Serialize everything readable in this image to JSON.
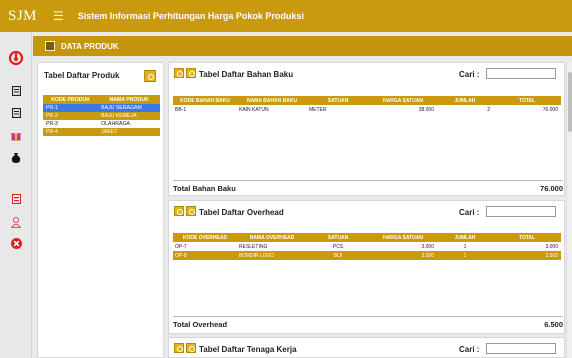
{
  "app": {
    "logo": "SJM",
    "title": "Sistem Informasi Perhitungan Harga Pokok Produksi"
  },
  "colors": {
    "brand": "#c99a0e",
    "selected": "#3a78e8",
    "red": "#e02020"
  },
  "sidebar_icons": [
    "power-icon",
    "document-icon",
    "document-icon",
    "gift-icon",
    "money-bag-icon",
    "report-icon",
    "user-icon",
    "close-icon"
  ],
  "page": {
    "title": "DATA PRODUK"
  },
  "produk": {
    "title": "Tabel Daftar Produk",
    "headers": [
      "KODE PRODUK",
      "NAMA PRODUK"
    ],
    "rows": [
      {
        "kode": "PR-1",
        "nama": "BAJU SERAGAM"
      },
      {
        "kode": "PR-2",
        "nama": "BAJU KEMEJA"
      },
      {
        "kode": "PR-3",
        "nama": "OLAHRAGA"
      },
      {
        "kode": "PR-4",
        "nama": "JAKET"
      }
    ]
  },
  "bahan_baku": {
    "title": "Tabel Daftar Bahan Baku",
    "search_label": "Cari :",
    "search_value": "",
    "headers": [
      "KODE BAHAN BAKU",
      "NAMA BAHAN BAKU",
      "SATUAN",
      "HARGA SATUAN",
      "JUMLAH",
      "TOTAL"
    ],
    "rows": [
      {
        "kode": "BB-1",
        "nama": "KAIN KATUN",
        "satuan": "METER",
        "harga": "38.000",
        "jumlah": "2",
        "total": "76.000"
      }
    ],
    "total_label": "Total Bahan Baku",
    "total_value": "76.000"
  },
  "overhead": {
    "title": "Tabel Daftar Overhead",
    "search_label": "Cari :",
    "search_value": "",
    "headers": [
      "KODE OVERHEAD",
      "NAMA OVERHEAD",
      "SATUAN",
      "HARGA SATUAN",
      "JUMLAH",
      "TOTAL"
    ],
    "rows": [
      {
        "kode": "OP-7",
        "nama": "RESLETING",
        "satuan": "PCS",
        "harga": "3.000",
        "jumlah": "1",
        "total": "3.000"
      },
      {
        "kode": "OP-8",
        "nama": "BORDIR LOGO",
        "satuan": "BIJI",
        "harga": "3.500",
        "jumlah": "1",
        "total": "3.500"
      }
    ],
    "total_label": "Total Overhead",
    "total_value": "6.500"
  },
  "tenaga_kerja": {
    "title": "Tabel Daftar Tenaga Kerja",
    "search_label": "Cari :",
    "search_value": ""
  }
}
